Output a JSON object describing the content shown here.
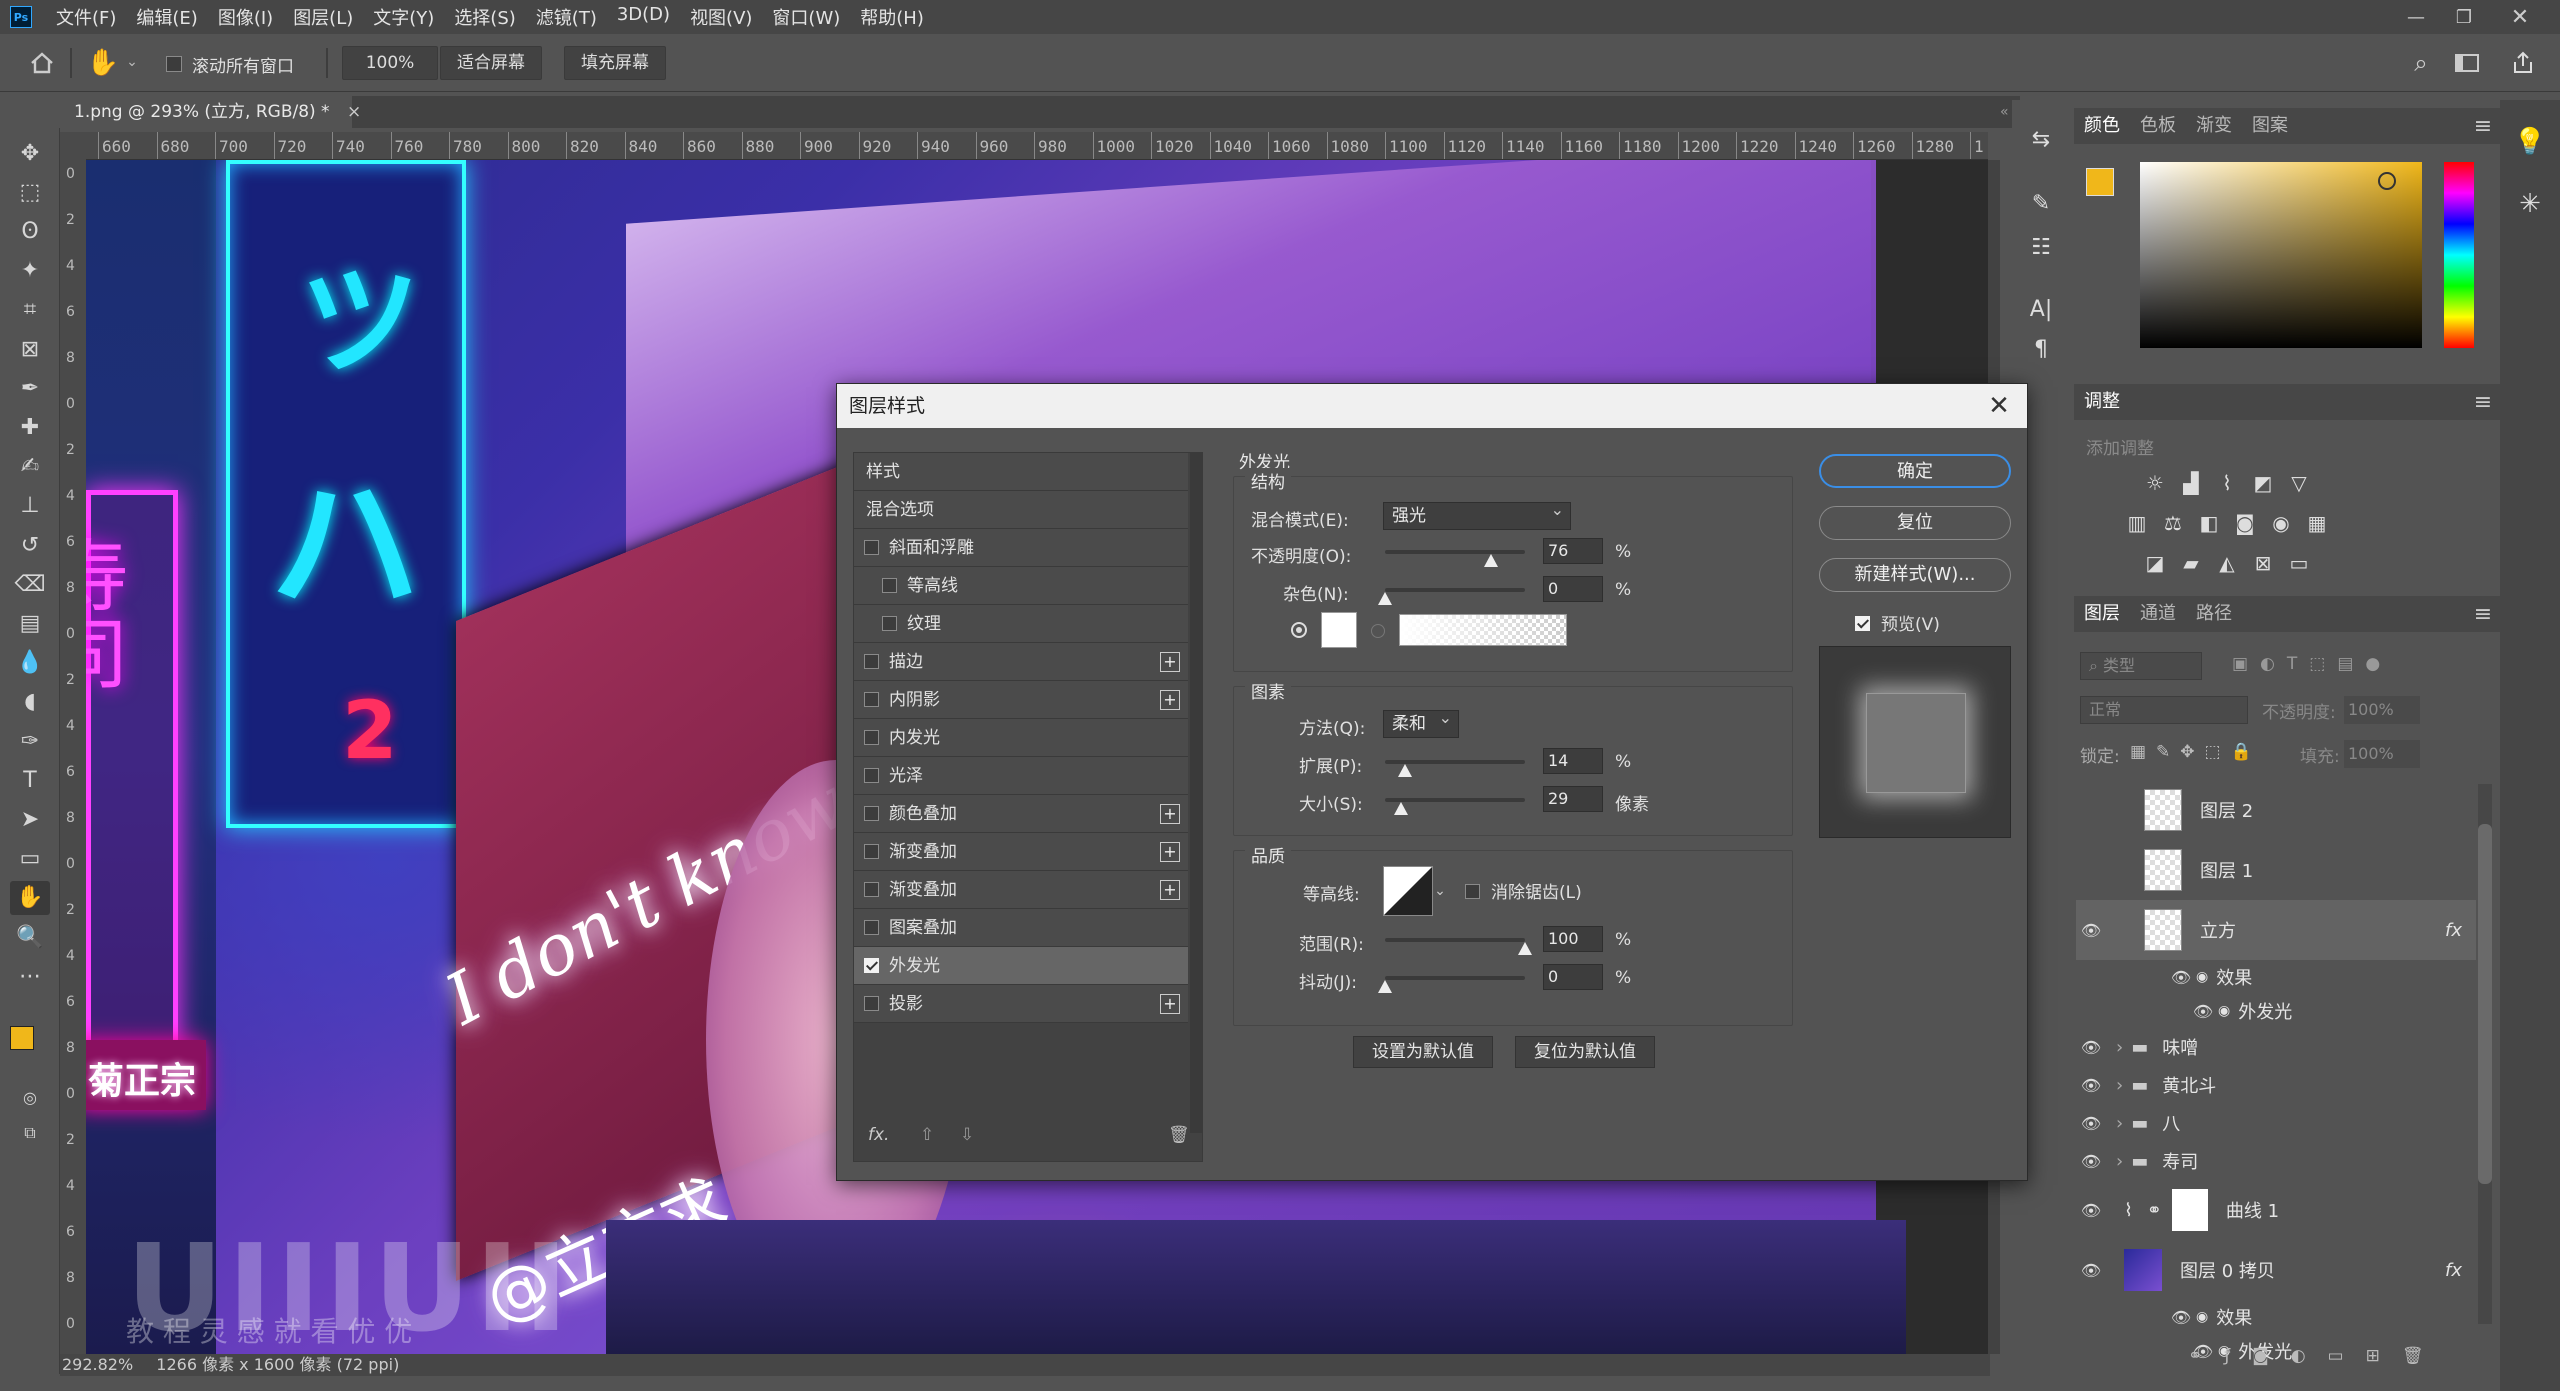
{
  "menubar": {
    "app_icon": "Ps",
    "items": [
      "文件(F)",
      "编辑(E)",
      "图像(I)",
      "图层(L)",
      "文字(Y)",
      "选择(S)",
      "滤镜(T)",
      "3D(D)",
      "视图(V)",
      "窗口(W)",
      "帮助(H)"
    ],
    "window_controls": [
      "minimize-icon",
      "restore-icon",
      "close-icon"
    ]
  },
  "options": {
    "scroll_all_label": "滚动所有窗口",
    "zoom": "100%",
    "fit_screen": "适合屏幕",
    "fill_screen": "填充屏幕"
  },
  "document": {
    "tab_title": "1.png @ 293% (立方, RGB/8) *",
    "close": "×"
  },
  "ruler": {
    "ticks": [
      "660",
      "680",
      "700",
      "720",
      "740",
      "760",
      "780",
      "800",
      "820",
      "840",
      "860",
      "880",
      "900",
      "920",
      "940",
      "960",
      "980",
      "1000",
      "1020",
      "1040",
      "1060",
      "1080",
      "1100",
      "1120",
      "1140",
      "1160",
      "1180",
      "1200",
      "1220",
      "1240",
      "1260",
      "1280",
      "1"
    ]
  },
  "vruler": {
    "ticks": [
      "0",
      "2",
      "4",
      "6",
      "8",
      "0",
      "2",
      "4",
      "6",
      "8",
      "0",
      "2",
      "4",
      "6",
      "8",
      "0",
      "2",
      "4",
      "6",
      "8",
      "0",
      "2",
      "4",
      "6",
      "8",
      "0"
    ]
  },
  "canvas": {
    "sign_katakana": [
      "ツ",
      "ハ"
    ],
    "sign_number": "2",
    "pink_sign": "寿司",
    "neon_text": "I don't know",
    "script_text": "@立方求",
    "red_sign": "菊正宗",
    "watermark": "UIIIUII",
    "watermark_sub": "教 程 灵 感 就 看 优 优"
  },
  "status": {
    "zoom": "292.82%",
    "dims": "1266 像素 x 1600 像素 (72 ppi)"
  },
  "right_panel": {
    "color_tabs": [
      "颜色",
      "色板",
      "渐变",
      "图案"
    ],
    "foreground": "#f0b71a",
    "adjust_tab": "调整",
    "add_adjust": "添加调整",
    "layer_tabs": [
      "图层",
      "通道",
      "路径"
    ],
    "filter_placeholder": "类型",
    "blend": "正常",
    "opacity_label": "不透明度:",
    "opacity_val": "100%",
    "lock_label": "锁定:",
    "fill_label": "填充:",
    "fill_val": "100%"
  },
  "layers": [
    {
      "name": "图层 2",
      "visible": false,
      "kind": "pixel"
    },
    {
      "name": "图层 1",
      "visible": false,
      "kind": "pixel"
    },
    {
      "name": "立方",
      "visible": true,
      "kind": "pixel",
      "fx": "fx",
      "selected": true
    },
    {
      "name": "效果",
      "visible": true,
      "kind": "effect-group"
    },
    {
      "name": "外发光",
      "visible": true,
      "kind": "effect"
    },
    {
      "name": "味噌",
      "visible": true,
      "kind": "folder"
    },
    {
      "name": "黄北斗",
      "visible": true,
      "kind": "folder"
    },
    {
      "name": "八",
      "visible": true,
      "kind": "folder"
    },
    {
      "name": "寿司",
      "visible": true,
      "kind": "folder"
    },
    {
      "name": "曲线 1",
      "visible": true,
      "kind": "adjustment"
    },
    {
      "name": "图层 0 拷贝",
      "visible": true,
      "kind": "image",
      "fx": "fx"
    },
    {
      "name": "效果",
      "visible": true,
      "kind": "effect-group"
    },
    {
      "name": "外发光",
      "visible": true,
      "kind": "effect"
    }
  ],
  "dialog": {
    "title": "图层样式",
    "styles_header": "样式",
    "blend_options": "混合选项",
    "styles": [
      {
        "label": "斜面和浮雕",
        "checked": false,
        "plus": false,
        "indent": false
      },
      {
        "label": "等高线",
        "checked": false,
        "plus": false,
        "indent": true
      },
      {
        "label": "纹理",
        "checked": false,
        "plus": false,
        "indent": true
      },
      {
        "label": "描边",
        "checked": false,
        "plus": true,
        "indent": false
      },
      {
        "label": "内阴影",
        "checked": false,
        "plus": true,
        "indent": false
      },
      {
        "label": "内发光",
        "checked": false,
        "plus": false,
        "indent": false
      },
      {
        "label": "光泽",
        "checked": false,
        "plus": false,
        "indent": false
      },
      {
        "label": "颜色叠加",
        "checked": false,
        "plus": true,
        "indent": false
      },
      {
        "label": "渐变叠加",
        "checked": false,
        "plus": true,
        "indent": false
      },
      {
        "label": "渐变叠加",
        "checked": false,
        "plus": true,
        "indent": false
      },
      {
        "label": "图案叠加",
        "checked": false,
        "plus": false,
        "indent": false
      },
      {
        "label": "外发光",
        "checked": true,
        "plus": false,
        "indent": false,
        "selected": true
      },
      {
        "label": "投影",
        "checked": false,
        "plus": true,
        "indent": false
      }
    ],
    "fx": "fx.",
    "outer_glow": "外发光",
    "structure": "结构",
    "blend_mode_label": "混合模式(E):",
    "blend_mode": "强光",
    "opacity_label": "不透明度(O):",
    "opacity": "76",
    "opacity_frac": 0.76,
    "noise_label": "杂色(N):",
    "noise": "0",
    "noise_frac": 0,
    "elements": "图素",
    "method_label": "方法(Q):",
    "method": "柔和",
    "spread_label": "扩展(P):",
    "spread": "14",
    "spread_frac": 0.14,
    "size_label": "大小(S):",
    "size": "29",
    "size_frac": 0.116,
    "quality": "品质",
    "contour_label": "等高线:",
    "antialias": "消除锯齿(L)",
    "range_label": "范围(R):",
    "range": "100",
    "range_frac": 1,
    "jitter_label": "抖动(J):",
    "jitter": "0",
    "jitter_frac": 0,
    "percent": "%",
    "pixels": "像素",
    "set_default": "设置为默认值",
    "reset_default": "复位为默认值",
    "ok": "确定",
    "reset": "复位",
    "new_style": "新建样式(W)...",
    "preview": "预览(V)"
  }
}
